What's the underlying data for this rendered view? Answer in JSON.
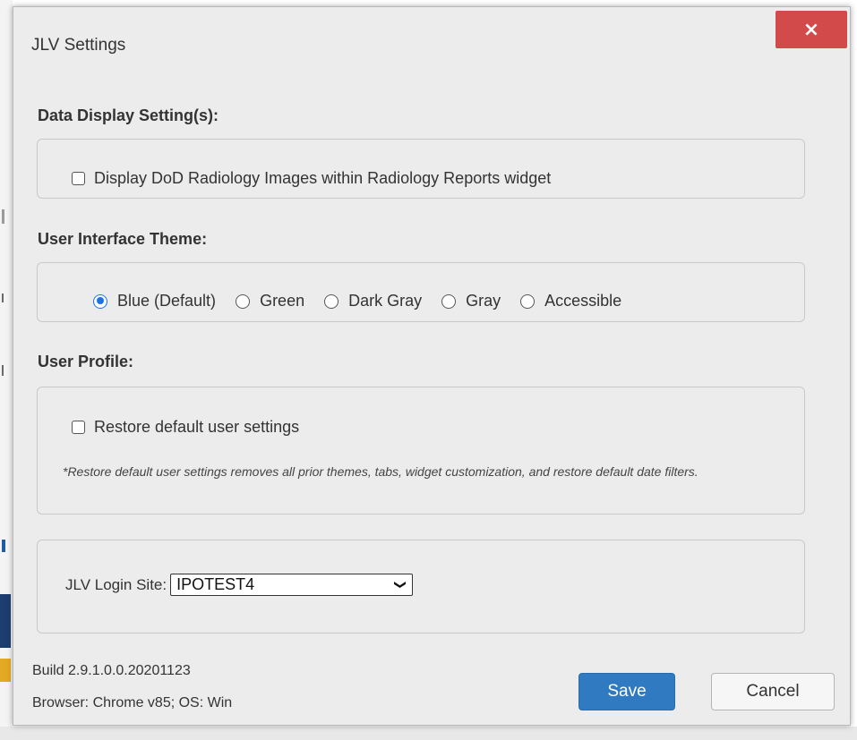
{
  "dialog": {
    "title": "JLV Settings",
    "close_label": "×"
  },
  "data_display": {
    "heading": "Data Display Setting(s):",
    "checkbox_label": "Display DoD Radiology Images within Radiology Reports widget",
    "checked": false
  },
  "theme": {
    "heading": "User Interface Theme:",
    "options": [
      {
        "label": "Blue (Default)",
        "selected": true
      },
      {
        "label": "Green",
        "selected": false
      },
      {
        "label": "Dark Gray",
        "selected": false
      },
      {
        "label": "Gray",
        "selected": false
      },
      {
        "label": "Accessible",
        "selected": false
      }
    ]
  },
  "user_profile": {
    "heading": "User Profile:",
    "checkbox_label": "Restore default user settings",
    "checked": false,
    "note": "*Restore default user settings removes all prior themes, tabs, widget customization, and restore default date filters."
  },
  "login_site": {
    "label": "JLV Login Site:",
    "value": "IPOTEST4"
  },
  "footer": {
    "build": "Build 2.9.1.0.0.20201123",
    "browser": "Browser: Chrome v85; OS: Win",
    "save_label": "Save",
    "cancel_label": "Cancel"
  },
  "colors": {
    "accent": "#1a73e8",
    "save_button": "#2f7ac1",
    "close_button": "#d24a4a",
    "dialog_bg": "#ececec"
  }
}
